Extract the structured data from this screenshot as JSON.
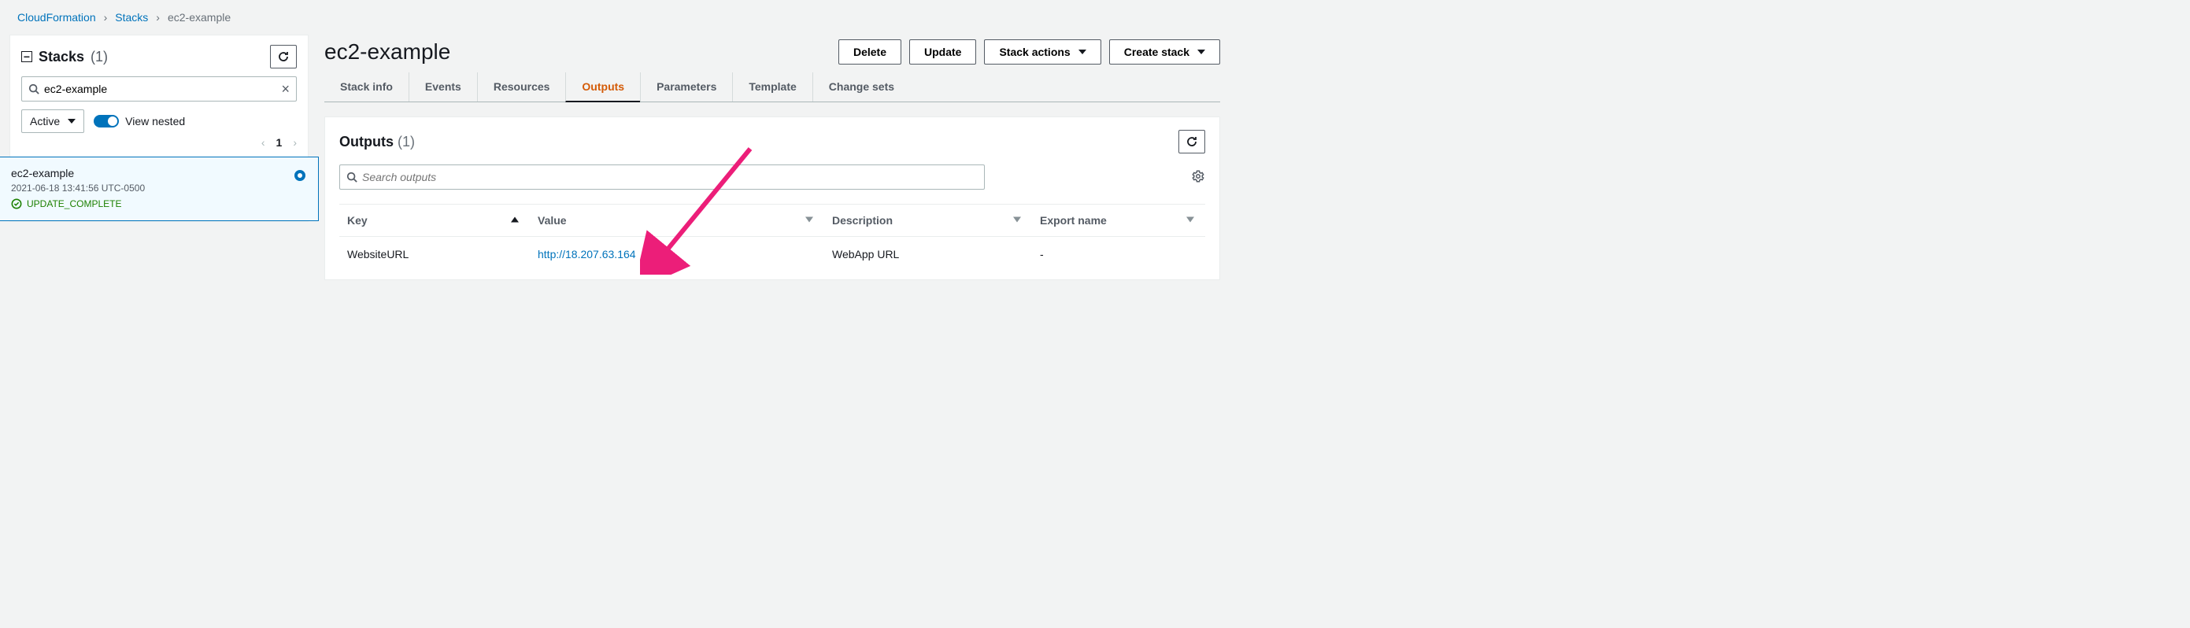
{
  "breadcrumb": {
    "root": "CloudFormation",
    "mid": "Stacks",
    "current": "ec2-example"
  },
  "sidebar": {
    "title": "Stacks",
    "count": "(1)",
    "filter_value": "ec2-example",
    "status_filter": "Active",
    "view_nested_label": "View nested",
    "page": "1",
    "item": {
      "name": "ec2-example",
      "timestamp": "2021-06-18 13:41:56 UTC-0500",
      "status": "UPDATE_COMPLETE"
    }
  },
  "main": {
    "title": "ec2-example",
    "buttons": {
      "delete": "Delete",
      "update": "Update",
      "stack_actions": "Stack actions",
      "create_stack": "Create stack"
    },
    "tabs": {
      "stack_info": "Stack info",
      "events": "Events",
      "resources": "Resources",
      "outputs": "Outputs",
      "parameters": "Parameters",
      "template": "Template",
      "change_sets": "Change sets"
    },
    "panel": {
      "title": "Outputs",
      "count": "(1)",
      "search_placeholder": "Search outputs",
      "columns": {
        "key": "Key",
        "value": "Value",
        "description": "Description",
        "export_name": "Export name"
      },
      "rows": [
        {
          "key": "WebsiteURL",
          "value": "http://18.207.63.164",
          "description": "WebApp URL",
          "export_name": "-"
        }
      ]
    }
  }
}
